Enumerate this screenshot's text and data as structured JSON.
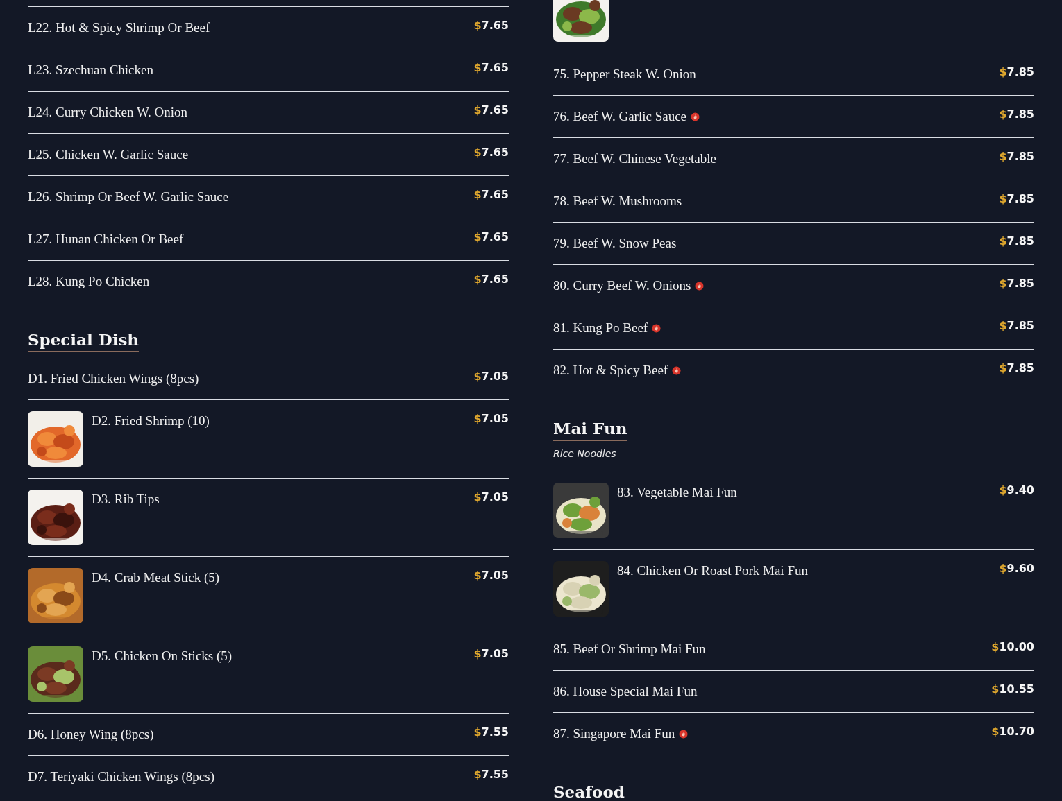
{
  "columns": [
    {
      "sections": [
        {
          "items": [
            {
              "kind": "plain",
              "name": "L22. Hot & Spicy Shrimp Or Beef",
              "currency": "$",
              "amount": "7.65",
              "spicy": false
            },
            {
              "kind": "plain",
              "name": "L23. Szechuan Chicken",
              "currency": "$",
              "amount": "7.65",
              "spicy": false
            },
            {
              "kind": "plain",
              "name": "L24. Curry Chicken W. Onion",
              "currency": "$",
              "amount": "7.65",
              "spicy": false
            },
            {
              "kind": "plain",
              "name": "L25. Chicken W. Garlic Sauce",
              "currency": "$",
              "amount": "7.65",
              "spicy": false
            },
            {
              "kind": "plain",
              "name": "L26. Shrimp Or Beef W. Garlic Sauce",
              "currency": "$",
              "amount": "7.65",
              "spicy": false
            },
            {
              "kind": "plain",
              "name": "L27. Hunan Chicken Or Beef",
              "currency": "$",
              "amount": "7.65",
              "spicy": false
            },
            {
              "kind": "plain",
              "name": "L28. Kung Po Chicken",
              "currency": "$",
              "amount": "7.65",
              "spicy": false
            }
          ]
        },
        {
          "title": "Special Dish",
          "items": [
            {
              "kind": "plain",
              "name": "D1. Fried Chicken Wings (8pcs)",
              "currency": "$",
              "amount": "7.05",
              "spicy": false
            },
            {
              "kind": "picture",
              "name": "D2. Fried Shrimp (10)",
              "currency": "$",
              "amount": "7.05",
              "spicy": false
            },
            {
              "kind": "picture",
              "name": "D3. Rib Tips",
              "currency": "$",
              "amount": "7.05",
              "spicy": false
            },
            {
              "kind": "picture",
              "name": "D4. Crab Meat Stick (5)",
              "currency": "$",
              "amount": "7.05",
              "spicy": false
            },
            {
              "kind": "picture",
              "name": "D5. Chicken On Sticks (5)",
              "currency": "$",
              "amount": "7.05",
              "spicy": false
            },
            {
              "kind": "plain",
              "name": "D6. Honey Wing (8pcs)",
              "currency": "$",
              "amount": "7.55",
              "spicy": false
            },
            {
              "kind": "plain",
              "name": "D7. Teriyaki Chicken Wings (8pcs)",
              "currency": "$",
              "amount": "7.55",
              "spicy": false
            }
          ]
        }
      ]
    },
    {
      "sections": [
        {
          "items": [
            {
              "kind": "picture"
            },
            {
              "kind": "plain",
              "name": "75. Pepper Steak W. Onion",
              "currency": "$",
              "amount": "7.85",
              "spicy": false
            },
            {
              "kind": "plain",
              "name": "76. Beef W. Garlic Sauce",
              "currency": "$",
              "amount": "7.85",
              "spicy": true
            },
            {
              "kind": "plain",
              "name": "77. Beef W. Chinese Vegetable",
              "currency": "$",
              "amount": "7.85",
              "spicy": false
            },
            {
              "kind": "plain",
              "name": "78. Beef W. Mushrooms",
              "currency": "$",
              "amount": "7.85",
              "spicy": false
            },
            {
              "kind": "plain",
              "name": "79. Beef W. Snow Peas",
              "currency": "$",
              "amount": "7.85",
              "spicy": false
            },
            {
              "kind": "plain",
              "name": "80. Curry Beef W. Onions",
              "currency": "$",
              "amount": "7.85",
              "spicy": true
            },
            {
              "kind": "plain",
              "name": "81. Kung Po Beef",
              "currency": "$",
              "amount": "7.85",
              "spicy": true
            },
            {
              "kind": "plain",
              "name": "82. Hot & Spicy Beef",
              "currency": "$",
              "amount": "7.85",
              "spicy": true
            }
          ]
        },
        {
          "title": "Mai Fun",
          "subtitle": "Rice Noodles",
          "items": [
            {
              "kind": "picture",
              "name": "83. Vegetable Mai Fun",
              "currency": "$",
              "amount": "9.40",
              "spicy": false
            },
            {
              "kind": "picture",
              "name": "84. Chicken Or Roast Pork Mai Fun",
              "currency": "$",
              "amount": "9.60",
              "spicy": false
            },
            {
              "kind": "plain",
              "name": "85. Beef Or Shrimp Mai Fun",
              "currency": "$",
              "amount": "10.00",
              "spicy": false
            },
            {
              "kind": "plain",
              "name": "86. House Special Mai Fun",
              "currency": "$",
              "amount": "10.55",
              "spicy": false
            },
            {
              "kind": "plain",
              "name": "87. Singapore Mai Fun",
              "currency": "$",
              "amount": "10.70",
              "spicy": true
            }
          ]
        },
        {
          "title": "Seafood"
        }
      ]
    }
  ]
}
